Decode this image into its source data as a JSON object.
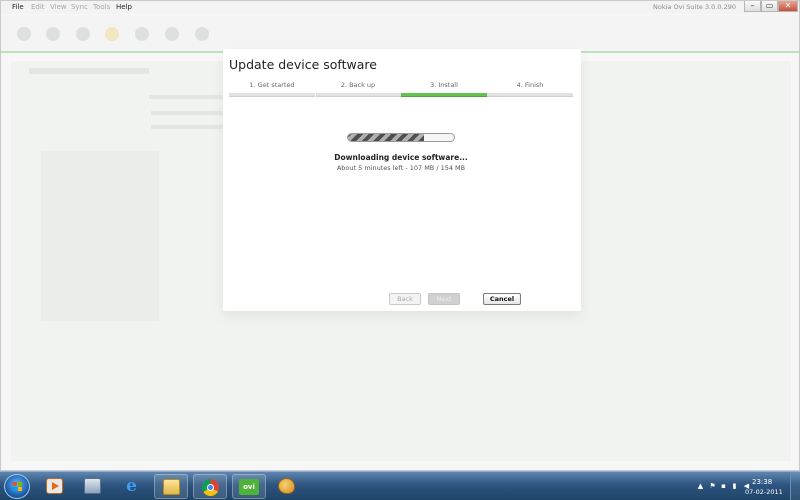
{
  "window": {
    "title": "Nokia Ovi Suite 3.0.0.290",
    "menus": [
      "File",
      "Edit",
      "View",
      "Sync",
      "Tools",
      "Help"
    ],
    "controls": {
      "minimize": "–",
      "maximize": "▭",
      "close": "✕"
    }
  },
  "dialog": {
    "title": "Update device software",
    "steps": [
      {
        "label": "1. Get started",
        "active": false
      },
      {
        "label": "2. Back up",
        "active": false
      },
      {
        "label": "3. Install",
        "active": true
      },
      {
        "label": "4. Finish",
        "active": false
      }
    ],
    "progress_fraction": 0.72,
    "status_title": "Downloading device software...",
    "status_detail": "About 5 minutes left - 107 MB / 154 MB",
    "buttons": {
      "back": "Back",
      "next": "Next",
      "cancel": "Cancel"
    }
  },
  "taskbar": {
    "pinned": [
      "media-player-icon",
      "calculator-icon",
      "internet-explorer-icon",
      "folder-icon",
      "chrome-icon",
      "ovi-suite-icon",
      "paint-icon"
    ],
    "ovi_label": "ovi",
    "tray": {
      "time": "23:38",
      "date": "07-02-2011"
    }
  },
  "colors": {
    "accent_green": "#65c350",
    "taskbar_blue": "#2d5580"
  }
}
